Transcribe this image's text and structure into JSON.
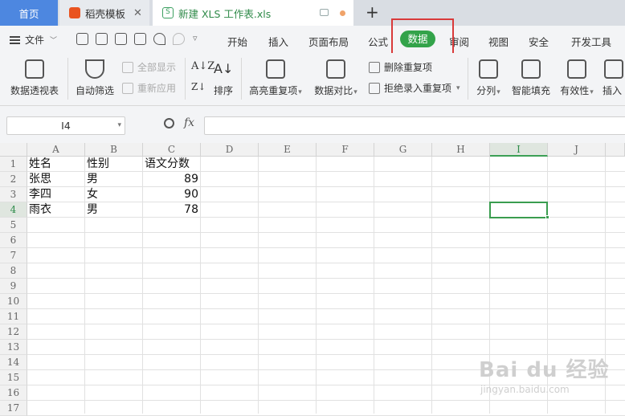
{
  "tabs": {
    "home": "首页",
    "template": "稻壳模板",
    "file": "新建 XLS 工作表.xls",
    "file_icon_letter": "S",
    "close_glyph": "✕",
    "add_glyph": "+"
  },
  "menu": {
    "file_label": "文件",
    "items": [
      "开始",
      "插入",
      "页面布局",
      "公式",
      "数据",
      "审阅",
      "视图",
      "安全",
      "开发工具"
    ],
    "active": "数据"
  },
  "ribbon": {
    "pivot_table": "数据透视表",
    "auto_filter": "自动筛选",
    "show_all": "全部显示",
    "reapply": "重新应用",
    "sort": "排序",
    "highlight_duplicates": "高亮重复项",
    "compare_data": "数据对比",
    "remove_duplicates": "删除重复项",
    "reject_duplicates": "拒绝录入重复项",
    "split_column": "分列",
    "flash_fill": "智能填充",
    "validity": "有效性",
    "insert": "插入"
  },
  "formula_bar": {
    "name_box": "I4",
    "fx_label": "fx",
    "formula": ""
  },
  "sheet": {
    "columns": [
      "A",
      "B",
      "C",
      "D",
      "E",
      "F",
      "G",
      "H",
      "I",
      "J"
    ],
    "selected_column": "I",
    "rows": [
      "1",
      "2",
      "3",
      "4",
      "5",
      "6",
      "7",
      "8",
      "9",
      "10",
      "11",
      "12",
      "13",
      "14",
      "15",
      "16",
      "17"
    ],
    "selected_row": "4",
    "header": [
      "姓名",
      "性别",
      "语文分数"
    ],
    "data": [
      [
        "张思",
        "男",
        "89"
      ],
      [
        "李四",
        "女",
        "90"
      ],
      [
        "雨衣",
        "男",
        "78"
      ]
    ]
  },
  "watermark": {
    "brand": "Bai du 经验",
    "url": "jingyan.baidu.com"
  },
  "colors": {
    "accent_green": "#33a34a",
    "home_tab_blue": "#4d87e0",
    "annotation_red": "#d93a3a"
  }
}
